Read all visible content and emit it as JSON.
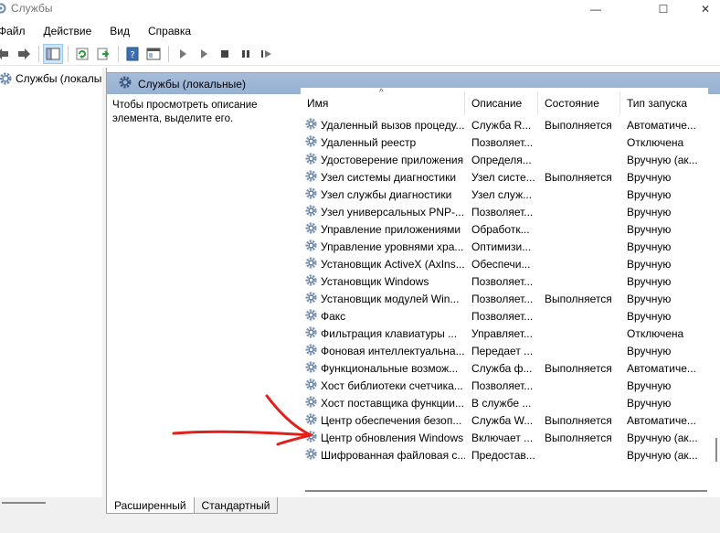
{
  "window": {
    "title": "Службы",
    "controls": {
      "minimize": "—",
      "maximize": "☐",
      "close": "✕"
    }
  },
  "menu": [
    "Файл",
    "Действие",
    "Вид",
    "Справка"
  ],
  "toolbar": {
    "buttons": [
      "back-icon",
      "forward-icon",
      "show-tree-icon",
      "refresh-icon",
      "export-icon",
      "help-icon",
      "properties-icon",
      "start-icon",
      "start-alt-icon",
      "stop-icon",
      "pause-icon",
      "restart-icon"
    ]
  },
  "tree": {
    "root_label": "Службы (локалы"
  },
  "pane": {
    "title": "Службы (локальные)",
    "description": "Чтобы просмотреть описание элемента, выделите его."
  },
  "columns": {
    "name": "Имя",
    "description": "Описание",
    "status": "Состояние",
    "startup": "Тип запуска"
  },
  "services": [
    {
      "name": "Удаленный вызов процеду...",
      "desc": "Служба R...",
      "status": "Выполняется",
      "startup": "Автоматиче..."
    },
    {
      "name": "Удаленный реестр",
      "desc": "Позволяет...",
      "status": "",
      "startup": "Отключена"
    },
    {
      "name": "Удостоверение приложения",
      "desc": "Определя...",
      "status": "",
      "startup": "Вручную (ак..."
    },
    {
      "name": "Узел системы диагностики",
      "desc": "Узел систе...",
      "status": "Выполняется",
      "startup": "Вручную"
    },
    {
      "name": "Узел службы диагностики",
      "desc": "Узел служ...",
      "status": "",
      "startup": "Вручную"
    },
    {
      "name": "Узел универсальных PNP-...",
      "desc": "Позволяет...",
      "status": "",
      "startup": "Вручную"
    },
    {
      "name": "Управление приложениями",
      "desc": "Обработк...",
      "status": "",
      "startup": "Вручную"
    },
    {
      "name": "Управление уровнями хра...",
      "desc": "Оптимизи...",
      "status": "",
      "startup": "Вручную"
    },
    {
      "name": "Установщик ActiveX (AxIns...",
      "desc": "Обеспечи...",
      "status": "",
      "startup": "Вручную"
    },
    {
      "name": "Установщик Windows",
      "desc": "Позволяет...",
      "status": "",
      "startup": "Вручную"
    },
    {
      "name": "Установщик модулей Win...",
      "desc": "Позволяет...",
      "status": "Выполняется",
      "startup": "Вручную"
    },
    {
      "name": "Факс",
      "desc": "Позволяет...",
      "status": "",
      "startup": "Вручную"
    },
    {
      "name": "Фильтрация клавиатуры ...",
      "desc": "Управляет...",
      "status": "",
      "startup": "Отключена"
    },
    {
      "name": "Фоновая интеллектуальна...",
      "desc": "Передает ...",
      "status": "",
      "startup": "Вручную"
    },
    {
      "name": "Функциональные возмож...",
      "desc": "Служба ф...",
      "status": "Выполняется",
      "startup": "Автоматиче..."
    },
    {
      "name": "Хост библиотеки счетчика...",
      "desc": "Позволяет...",
      "status": "",
      "startup": "Вручную"
    },
    {
      "name": "Хост поставщика функции...",
      "desc": "В службе ...",
      "status": "",
      "startup": "Вручную"
    },
    {
      "name": "Центр обеспечения безоп...",
      "desc": "Служба W...",
      "status": "Выполняется",
      "startup": "Автоматиче..."
    },
    {
      "name": "Центр обновления Windows",
      "desc": "Включает ...",
      "status": "Выполняется",
      "startup": "Вручную (ак..."
    },
    {
      "name": "Шифрованная файловая с...",
      "desc": "Предостав...",
      "status": "",
      "startup": "Вручную (ак..."
    }
  ],
  "tabs": [
    "Расширенный",
    "Стандартный"
  ],
  "colors": {
    "header_bg": "#a6bcd9",
    "annotation": "#e0201c"
  }
}
